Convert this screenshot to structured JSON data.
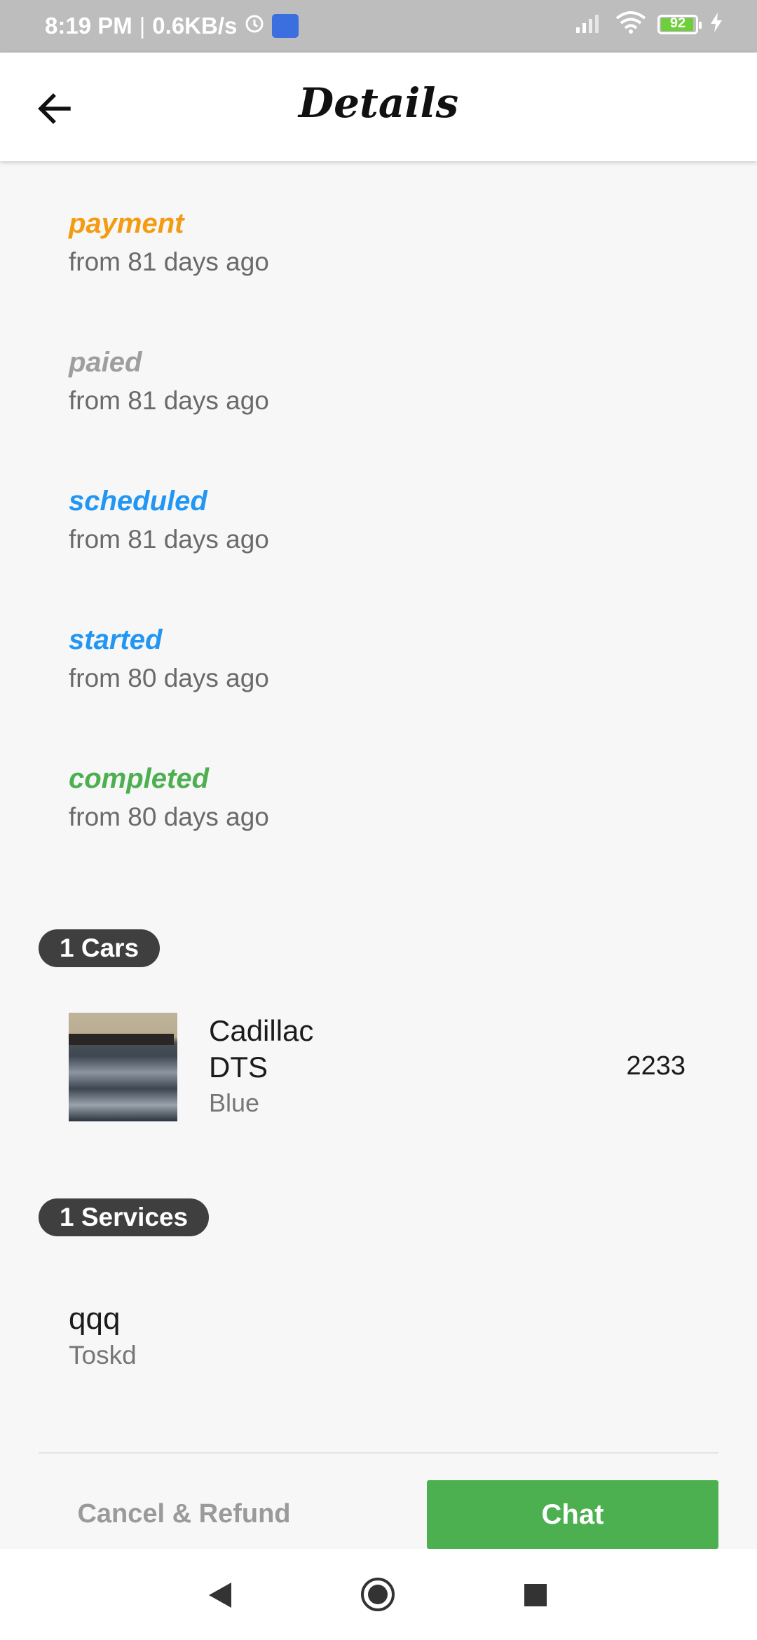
{
  "status_bar": {
    "time": "8:19 PM",
    "speed": "0.6KB/s",
    "battery": "92",
    "icons": [
      "alarm-icon",
      "app-notification-icon",
      "signal-icon",
      "wifi-icon",
      "battery-icon",
      "charging-icon"
    ]
  },
  "header": {
    "title": "Details",
    "back_icon": "arrow-left-icon"
  },
  "timeline": [
    {
      "status": "payment",
      "time": "from 81 days ago",
      "color": "#f39c12"
    },
    {
      "status": "paied",
      "time": "from 81 days ago",
      "color": "#9e9e9e"
    },
    {
      "status": "scheduled",
      "time": "from 81 days ago",
      "color": "#2196f3"
    },
    {
      "status": "started",
      "time": "from 80 days ago",
      "color": "#2196f3"
    },
    {
      "status": "completed",
      "time": "from 80 days ago",
      "color": "#4caf50"
    }
  ],
  "cars_section": {
    "chip": "1 Cars",
    "items": [
      {
        "name_line1": "Cadillac",
        "name_line2": "DTS",
        "color": "Blue",
        "plate": "2233"
      }
    ]
  },
  "services_section": {
    "chip": "1 Services",
    "items": [
      {
        "name": "qqq",
        "description": "Toskd"
      }
    ]
  },
  "actions": {
    "cancel_label": "Cancel & Refund",
    "chat_label": "Chat"
  },
  "colors": {
    "accent_green": "#4caf50",
    "chip_bg": "#3f3f3f"
  }
}
